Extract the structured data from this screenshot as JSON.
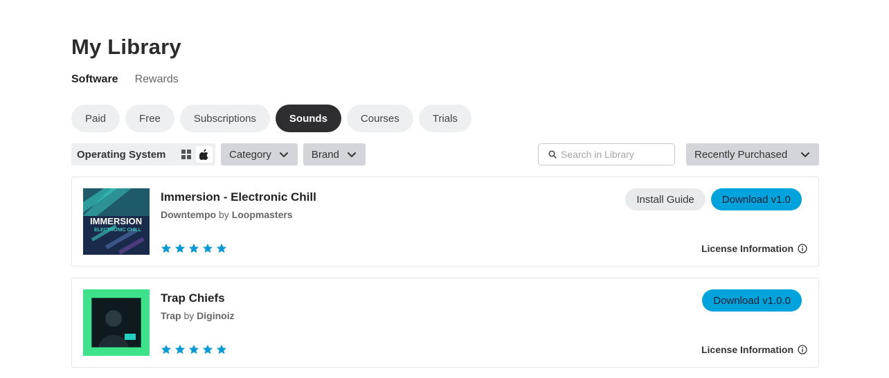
{
  "page": {
    "title": "My Library"
  },
  "top_tabs": [
    {
      "label": "Software",
      "active": true
    },
    {
      "label": "Rewards",
      "active": false
    }
  ],
  "pills": [
    {
      "label": "Paid",
      "active": false
    },
    {
      "label": "Free",
      "active": false
    },
    {
      "label": "Subscriptions",
      "active": false
    },
    {
      "label": "Sounds",
      "active": true
    },
    {
      "label": "Courses",
      "active": false
    },
    {
      "label": "Trials",
      "active": false
    }
  ],
  "filters": {
    "os_label": "Operating System",
    "os_options": [
      "windows-icon",
      "apple-icon"
    ],
    "os_selected": "apple-icon",
    "category_label": "Category",
    "brand_label": "Brand"
  },
  "search": {
    "placeholder": "Search in Library",
    "value": ""
  },
  "sort": {
    "selected": "Recently Purchased"
  },
  "colors": {
    "accent": "#00a3db",
    "star": "#0a9ad6",
    "active_pill": "#2e2e31"
  },
  "products": [
    {
      "title": "Immersion - Electronic Chill",
      "genre": "Downtempo",
      "by": "by",
      "brand": "Loopmasters",
      "rating": 5,
      "install_guide_label": "Install Guide",
      "download_label": "Download v1.0",
      "license_label": "License Information",
      "cover_text": "IMMERSION",
      "cover_subtext": "ELECTRONIC CHILL"
    },
    {
      "title": "Trap Chiefs",
      "genre": "Trap",
      "by": "by",
      "brand": "Diginoiz",
      "rating": 5,
      "download_label": "Download v1.0.0",
      "license_label": "License Information"
    }
  ]
}
